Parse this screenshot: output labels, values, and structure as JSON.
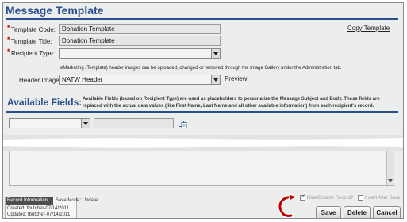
{
  "window": {
    "title": "Message Template"
  },
  "form": {
    "template_code": {
      "label": "Template Code:",
      "value": "Donation Template",
      "required": "*"
    },
    "template_title": {
      "label": "Template Title:",
      "value": "Donation Template",
      "required": "*"
    },
    "recipient_type": {
      "label": "Recipient Type:",
      "value": "",
      "required": "*"
    },
    "copy_template_link": "Copy Template",
    "header_image_note": "eMarketing (Template) header images can be uploaded, changed or removed through the Image Gallery under the Administration tab.",
    "header_image": {
      "label": "Header Image:",
      "value": "NATW Header"
    },
    "preview_link": "Preview"
  },
  "available_fields": {
    "title": "Available Fields:",
    "description": "Available Fields (based on Recipient Type) are used as placeholders to personalize the Message Subject and Body. These fields are replaced with the actual data values (like First Name, Last Name and all other available information) from each recipient's record.",
    "field_select_value": "",
    "field_text_value": ""
  },
  "footer": {
    "record_info_title": "Record Information",
    "save_mode_label": "Save Mode:",
    "save_mode_value": "Update",
    "created": "Created: tbutcher-07/14/2011",
    "updated": "Updated: tbutcher-07/14/2011",
    "hide_disable_label": "Hide/Disable Record?",
    "hide_disable_checked": true,
    "insert_after_save_label": "Insert After Save",
    "insert_after_save_checked": false,
    "buttons": {
      "save": "Save",
      "delete": "Delete",
      "cancel": "Cancel"
    }
  },
  "colors": {
    "accent": "#2a4e8c",
    "required": "#c00000",
    "callout": "#c00000"
  },
  "icons": {
    "copy_field": "documents-icon",
    "callout": "curved-arrow-icon"
  }
}
